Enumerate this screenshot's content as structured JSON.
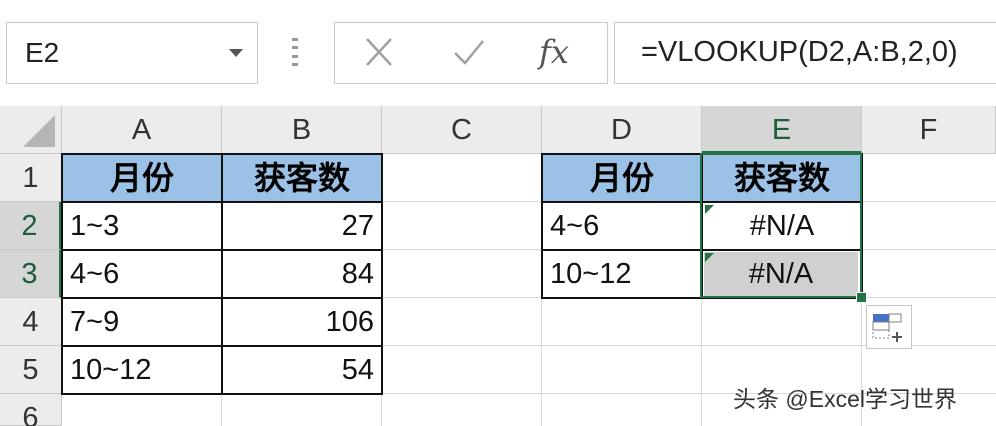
{
  "name_box": {
    "value": "E2"
  },
  "formula_bar": {
    "icons": [
      "cancel-icon",
      "enter-icon",
      "function-icon"
    ],
    "fx_label": "fx",
    "formula": "=VLOOKUP(D2,A:B,2,0)"
  },
  "columns": [
    "A",
    "B",
    "C",
    "D",
    "E",
    "F"
  ],
  "selected_column": "E",
  "rows": [
    "1",
    "2",
    "3",
    "4",
    "5",
    "6"
  ],
  "selected_rows": [
    "2",
    "3"
  ],
  "table1": {
    "headers": [
      "月份",
      "获客数"
    ],
    "rows": [
      [
        "1~3",
        "27"
      ],
      [
        "4~6",
        "84"
      ],
      [
        "7~9",
        "106"
      ],
      [
        "10~12",
        "54"
      ]
    ]
  },
  "table2": {
    "headers": [
      "月份",
      "获客数"
    ],
    "rows": [
      [
        "4~6",
        "#N/A"
      ],
      [
        "10~12",
        "#N/A"
      ]
    ]
  },
  "colors": {
    "header_fill": "#9bc2e6",
    "selection": "#217346",
    "selected_cell_fill": "#d0d0d0"
  },
  "watermark": "头条 @Excel学习世界"
}
